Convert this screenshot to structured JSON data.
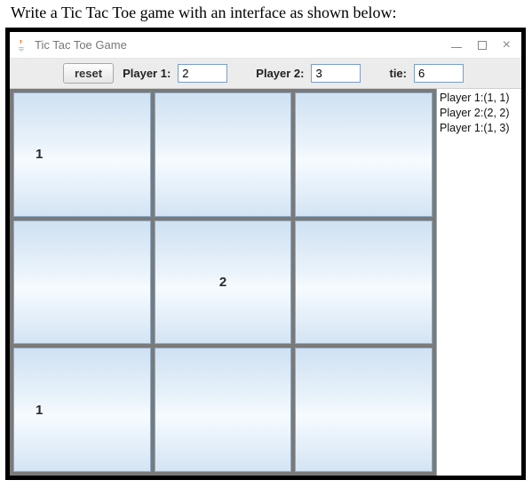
{
  "instruction": "Write a Tic Tac Toe game with an interface as shown below:",
  "window": {
    "title": "Tic Tac Toe Game",
    "icon": "java-icon"
  },
  "toolbar": {
    "reset_label": "reset",
    "player1_label": "Player 1:",
    "player1_value": "2",
    "player2_label": "Player 2:",
    "player2_value": "3",
    "tie_label": "tie:",
    "tie_value": "6"
  },
  "board": {
    "cells": [
      "1",
      "",
      "",
      "",
      "2",
      "",
      "1",
      "",
      ""
    ]
  },
  "log": {
    "lines": [
      "Player 1:(1, 1)",
      "Player 2:(2, 2)",
      "Player 1:(1, 3)"
    ]
  }
}
